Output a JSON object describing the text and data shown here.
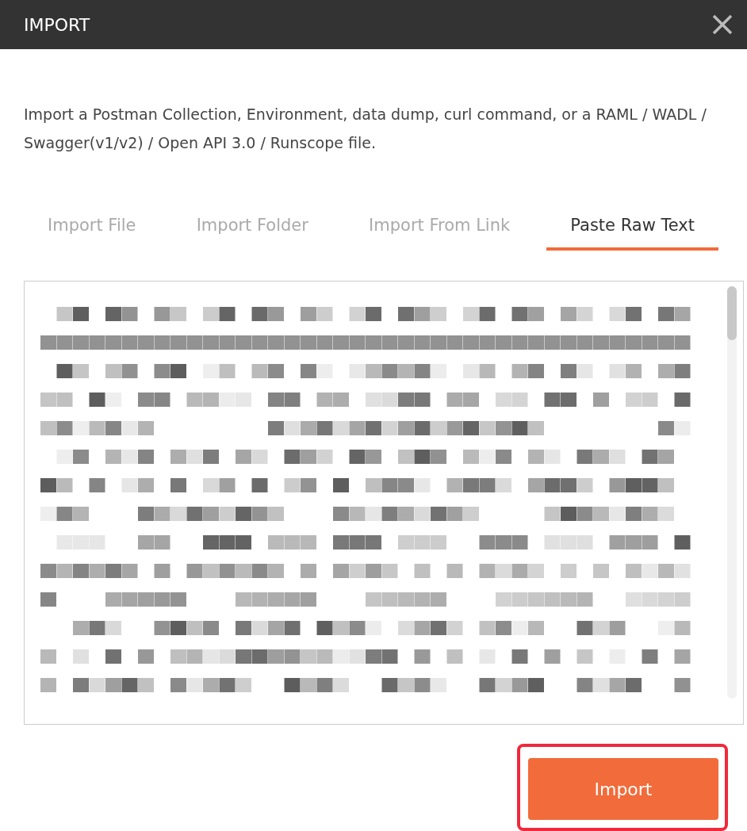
{
  "dialog": {
    "title": "IMPORT",
    "description": "Import a Postman Collection, Environment, data dump, curl command, or a RAML / WADL / Swagger(v1/v2) / Open API 3.0 / Runscope file."
  },
  "tabs": [
    {
      "label": "Import File",
      "selected": false
    },
    {
      "label": "Import Folder",
      "selected": false
    },
    {
      "label": "Import From Link",
      "selected": false
    },
    {
      "label": "Paste Raw Text",
      "selected": true
    }
  ],
  "import_button": {
    "label": "Import",
    "highlighted": true
  }
}
